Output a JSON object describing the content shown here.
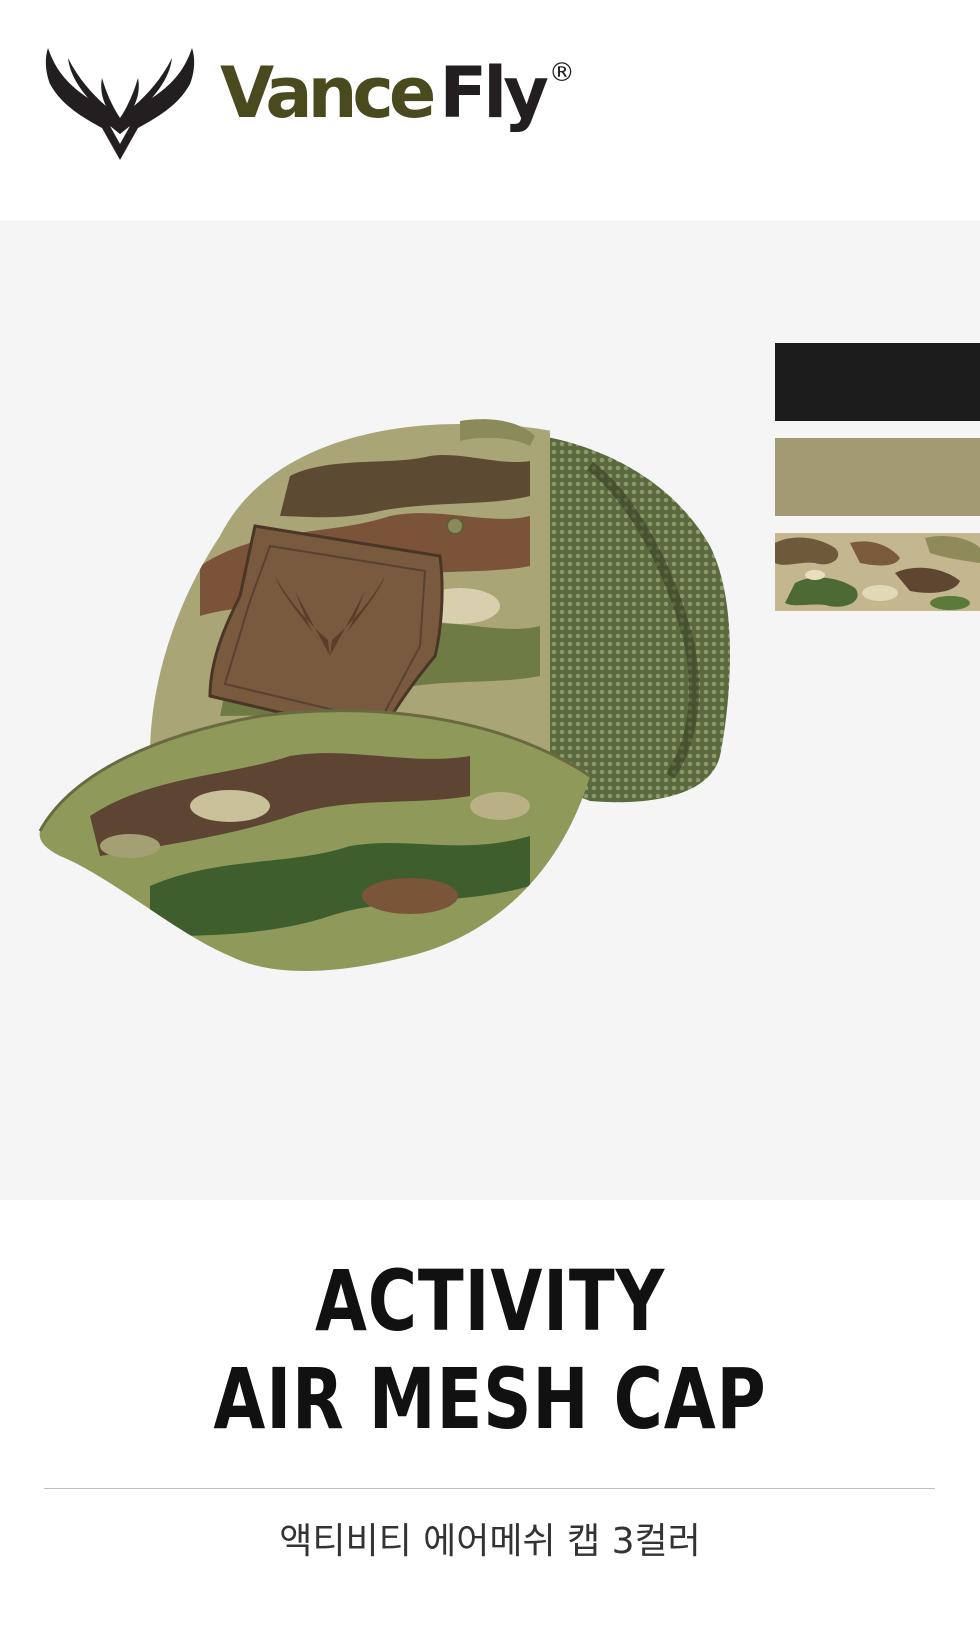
{
  "brand": {
    "word_part1": "Vance",
    "word_part2": "Fly",
    "registered": "®",
    "icon": "wings-logo-icon",
    "colors": {
      "vance": "#4a4a1f",
      "fly": "#231f20"
    }
  },
  "product": {
    "image": "camo-mesh-cap-image",
    "swatches": [
      {
        "name": "black",
        "color": "#1c1c1c"
      },
      {
        "name": "khaki",
        "color": "#a29a73"
      },
      {
        "name": "multicam",
        "color": "camo"
      }
    ],
    "title_line1": "ACTIVITY",
    "title_line2": "AIR MESH CAP",
    "subtitle": "액티비티 에어메쉬 캡 3컬러"
  }
}
